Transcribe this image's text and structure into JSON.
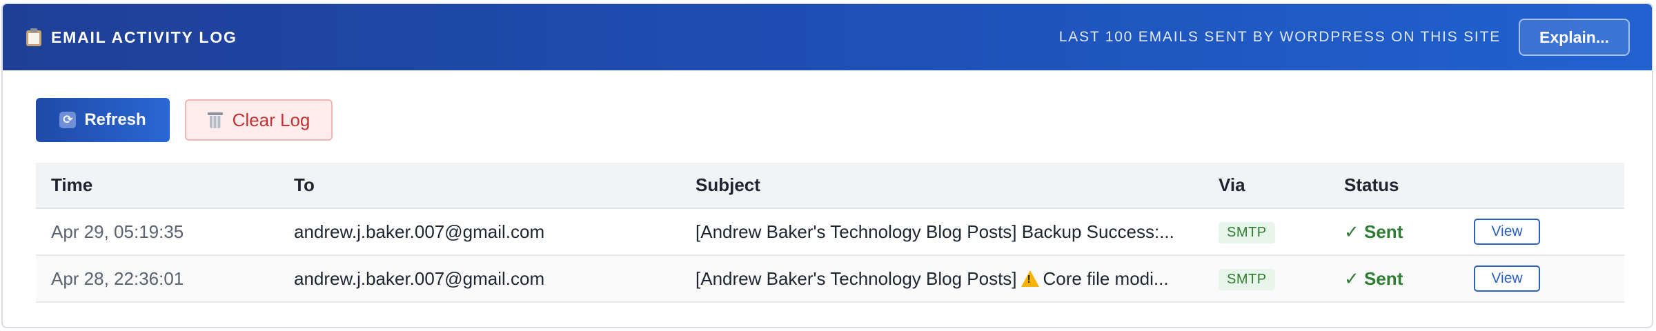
{
  "header": {
    "icon": "clipboard-icon",
    "title": "EMAIL ACTIVITY LOG",
    "subtitle": "LAST 100 EMAILS SENT BY WORDPRESS ON THIS SITE",
    "explain_label": "Explain..."
  },
  "toolbar": {
    "refresh_label": "Refresh",
    "refresh_icon": "refresh-icon",
    "clear_label": "Clear Log",
    "clear_icon": "trash-icon"
  },
  "table": {
    "columns": [
      "Time",
      "To",
      "Subject",
      "Via",
      "Status",
      ""
    ],
    "rows": [
      {
        "time": "Apr 29, 05:19:35",
        "to": "andrew.j.baker.007@gmail.com",
        "subject_prefix": "[Andrew Baker's Technology Blog Posts] Backup Success:...",
        "subject_suffix": "",
        "has_warning": false,
        "via": "SMTP",
        "status": "✓ Sent",
        "action": "View"
      },
      {
        "time": "Apr 28, 22:36:01",
        "to": "andrew.j.baker.007@gmail.com",
        "subject_prefix": "[Andrew Baker's Technology Blog Posts]",
        "subject_suffix": "Core file modi...",
        "has_warning": true,
        "via": "SMTP",
        "status": "✓ Sent",
        "action": "View"
      }
    ]
  },
  "colors": {
    "header_gradient_start": "#1f3f96",
    "header_gradient_end": "#2162d0",
    "sent_green": "#2e7d32",
    "clear_red": "#c43333",
    "accent_blue": "#2a5fc4"
  }
}
